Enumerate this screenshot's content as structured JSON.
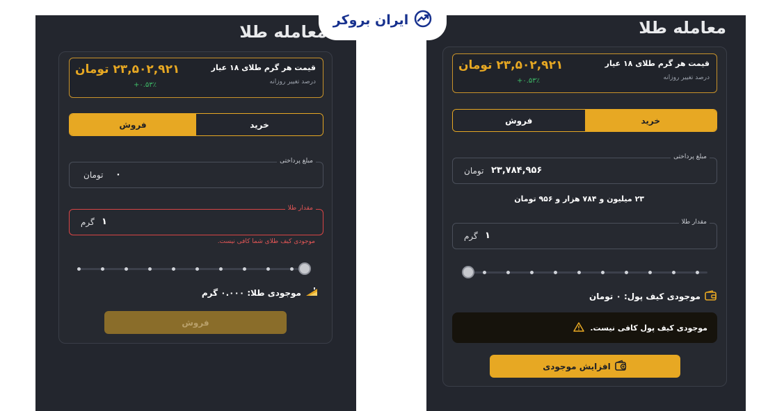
{
  "brand": {
    "logo_text": "ایران بروکر",
    "color": "#17318e"
  },
  "colors": {
    "gold": "#e7a823",
    "error": "#e05555",
    "positive": "#3fbf6a",
    "background": "#23262e"
  },
  "left_panel": {
    "title": "معامله طلا",
    "price_label": "قیمت هر گرم طلای ۱۸ عیار",
    "change_label": "درصد تغییر روزانه",
    "price_value": "۲۳,۵۰۲,۹۲۱ تومان",
    "change_value": "+۰.۵۳٪",
    "tabs": {
      "buy": "خرید",
      "sell": "فروش",
      "active": "sell"
    },
    "payment_field": {
      "legend": "مبلغ پرداختی",
      "value": "۰",
      "unit": "تومان"
    },
    "amount_field": {
      "legend": "مقدار طلا",
      "value": "۱",
      "unit": "گرم"
    },
    "error_text": "موجودی کیف طلای شما کافی نیست.",
    "slider": {
      "value_fraction": 1.0
    },
    "balance_text": "موجودی طلا: ۰.۰۰۰ گرم",
    "balance_icon": "gold-bar-icon",
    "sell_button": "فروش"
  },
  "right_panel": {
    "title": "معامله طلا",
    "price_label": "قیمت هر گرم طلای ۱۸ عیار",
    "change_label": "درصد تغییر روزانه",
    "price_value": "۲۳,۵۰۲,۹۲۱ تومان",
    "change_value": "+۰.۵۳٪",
    "tabs": {
      "buy": "خرید",
      "sell": "فروش",
      "active": "buy"
    },
    "payment_field": {
      "legend": "مبلغ پرداختی",
      "value": "۲۳,۷۸۴,۹۵۶",
      "unit": "تومان"
    },
    "amount_words": "۲۳ میلیون و ۷۸۴ هزار و ۹۵۶ تومان",
    "amount_field": {
      "legend": "مقدار طلا",
      "value": "۱",
      "unit": "گرم"
    },
    "slider": {
      "value_fraction": 0.0
    },
    "balance_text": "موجودی کیف پول: ۰ تومان",
    "balance_icon": "wallet-icon",
    "warning_text": "موجودی کیف پول کافی نیست.",
    "warning_icon": "warning-icon",
    "deposit_button": "افزایش موجودی",
    "deposit_icon": "wallet-add-icon"
  }
}
